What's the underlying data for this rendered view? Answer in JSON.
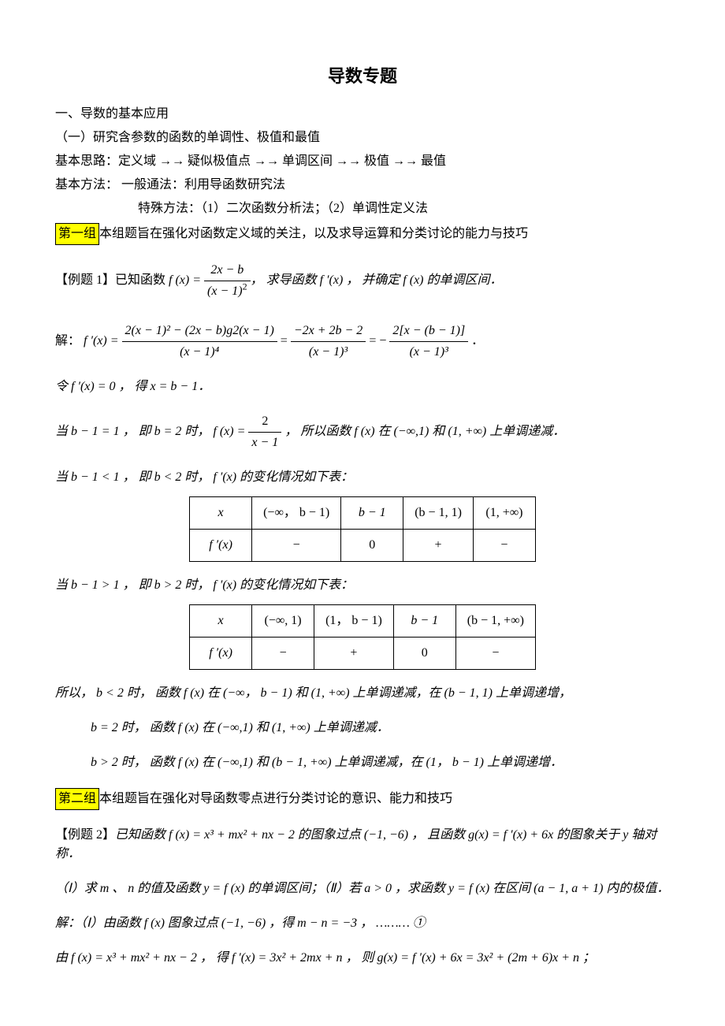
{
  "title": "导数专题",
  "section1": "一、导数的基本应用",
  "sub1": "（一）研究含参数的函数的单调性、极值和最值",
  "sub2": "基本思路：定义域 →→ 疑似极值点 →→ 单调区间 →→ 极值 →→ 最值",
  "sub3": "基本方法：   一般通法：利用导函数研究法",
  "sub4": "特殊方法：（1）二次函数分析法；（2）单调性定义法",
  "group1_tag": "第一组",
  "group1_text": "本组题旨在强化对函数定义域的关注，以及求导运算和分类讨论的能力与技巧",
  "example1_label": "【例题 1】",
  "example1_known": "已知函数 ",
  "example1_fx": "f (x) = ",
  "example1_num": "2x − b",
  "example1_den": "(x − 1)",
  "example1_tail": "， 求导函数 f ′(x) ， 并确定 f (x) 的单调区间．",
  "solution_label": "解： ",
  "derivative_lhs": "f ′(x) = ",
  "d_num1": "2(x − 1)² − (2x − b)g2(x − 1)",
  "d_den1": "(x − 1)⁴",
  "d_num2": "−2x + 2b − 2",
  "d_den2": "(x − 1)³",
  "d_num3": "2[x − (b − 1)]",
  "d_den3": "(x − 1)³",
  "let_line": "令 f ′(x) = 0 ， 得 x = b − 1．",
  "case_a_pre": "当 b − 1 = 1 ， 即 b = 2 时， ",
  "case_a_fx": "f (x) = ",
  "case_a_num": "2",
  "case_a_den": "x − 1",
  "case_a_post": "， 所以函数 f (x) 在 (−∞,1) 和 (1, +∞) 上单调递减．",
  "case_b": "当 b − 1 < 1 ， 即 b < 2 时， f ′(x) 的变化情况如下表：",
  "case_c": "当 b − 1 > 1 ， 即 b > 2 时， f ′(x) 的变化情况如下表：",
  "table1": {
    "r1": [
      "x",
      "(−∞， b − 1)",
      "b − 1",
      "(b − 1, 1)",
      "(1, +∞)"
    ],
    "r2": [
      "f ′(x)",
      "−",
      "0",
      "+",
      "−"
    ]
  },
  "table2": {
    "r1": [
      "x",
      "(−∞, 1)",
      "(1， b − 1)",
      "b − 1",
      "(b − 1, +∞)"
    ],
    "r2": [
      "f ′(x)",
      "−",
      "+",
      "0",
      "−"
    ]
  },
  "concl_intro": "所以， ",
  "concl_b_lt2": "b < 2 时， 函数 f (x) 在 (−∞， b − 1) 和 (1, +∞) 上单调递减，在 (b − 1, 1) 上单调递增，",
  "concl_b_eq2": "b = 2 时， 函数 f (x) 在 (−∞,1) 和 (1, +∞) 上单调递减．",
  "concl_b_gt2": "b > 2 时， 函数 f (x) 在 (−∞,1) 和 (b − 1, +∞) 上单调递减，在 (1， b − 1) 上单调递增．",
  "group2_tag": "第二组",
  "group2_text": "本组题旨在强化对导函数零点进行分类讨论的意识、能力和技巧",
  "example2_label": "【例题 2】",
  "example2_text": "已知函数 f (x) = x³ + mx² + nx − 2 的图象过点 (−1, −6) ， 且函数 g(x) = f ′(x) + 6x 的图象关于 y 轴对称．",
  "example2_part": "（Ⅰ）求 m 、 n 的值及函数 y = f (x) 的单调区间；（Ⅱ）若 a > 0 ，求函数 y = f (x) 在区间 (a − 1, a + 1) 内的极值．",
  "sol2_line1": "解：（Ⅰ）由函数 f (x) 图象过点 (−1, −6) ，得 m − n = −3 ， ……… ①",
  "sol2_line2": "由 f (x) = x³ + mx² + nx − 2 ， 得 f ′(x) = 3x² + 2mx + n ， 则 g(x) = f ′(x) + 6x = 3x² + (2m + 6)x + n ；"
}
